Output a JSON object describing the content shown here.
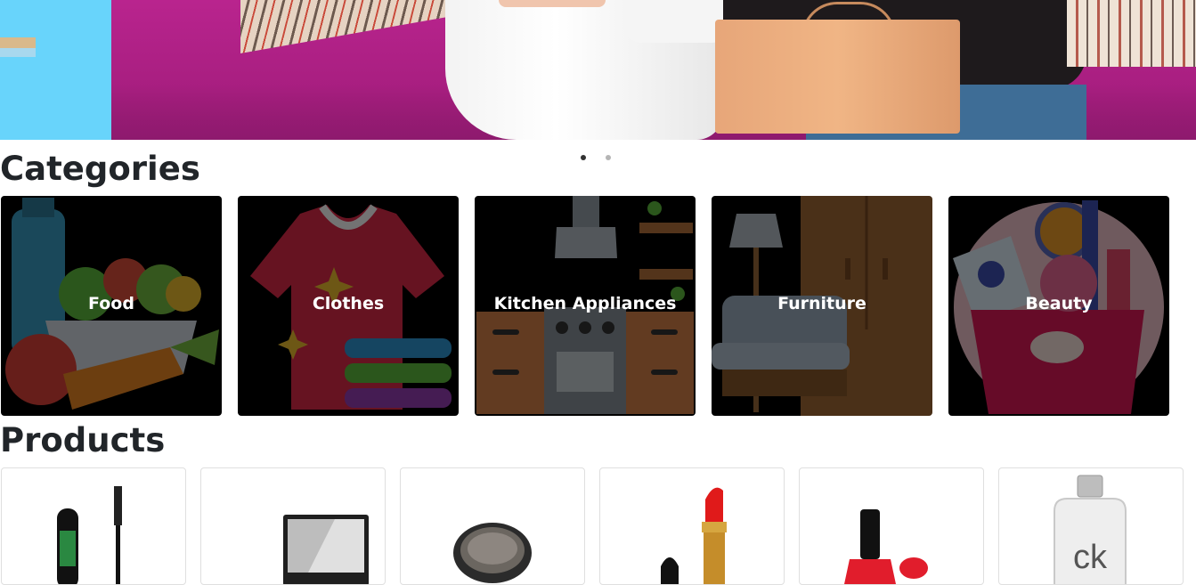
{
  "carousel": {
    "slides": 2,
    "active_index": 0
  },
  "categories": {
    "title": "Categories",
    "items": [
      {
        "label": "Food",
        "icon": "food-icon"
      },
      {
        "label": "Clothes",
        "icon": "clothes-icon"
      },
      {
        "label": "Kitchen Appliances",
        "icon": "kitchen-icon"
      },
      {
        "label": "Furniture",
        "icon": "furniture-icon"
      },
      {
        "label": "Beauty",
        "icon": "beauty-icon"
      }
    ]
  },
  "products": {
    "title": "Products",
    "items": [
      {
        "name": "mascara",
        "icon": "mascara-image"
      },
      {
        "name": "mirror",
        "icon": "mirror-image"
      },
      {
        "name": "compact powder",
        "icon": "compact-image"
      },
      {
        "name": "lipstick",
        "icon": "lipstick-image"
      },
      {
        "name": "nail polish",
        "icon": "nail-polish-image"
      },
      {
        "name": "ck perfume",
        "icon": "perfume-image",
        "brand_text": "ck"
      }
    ]
  },
  "colors": {
    "hero_magenta": "#b51f89",
    "hero_cyan": "#68d4fb",
    "text": "#212529",
    "card_overlay": "#000000"
  }
}
